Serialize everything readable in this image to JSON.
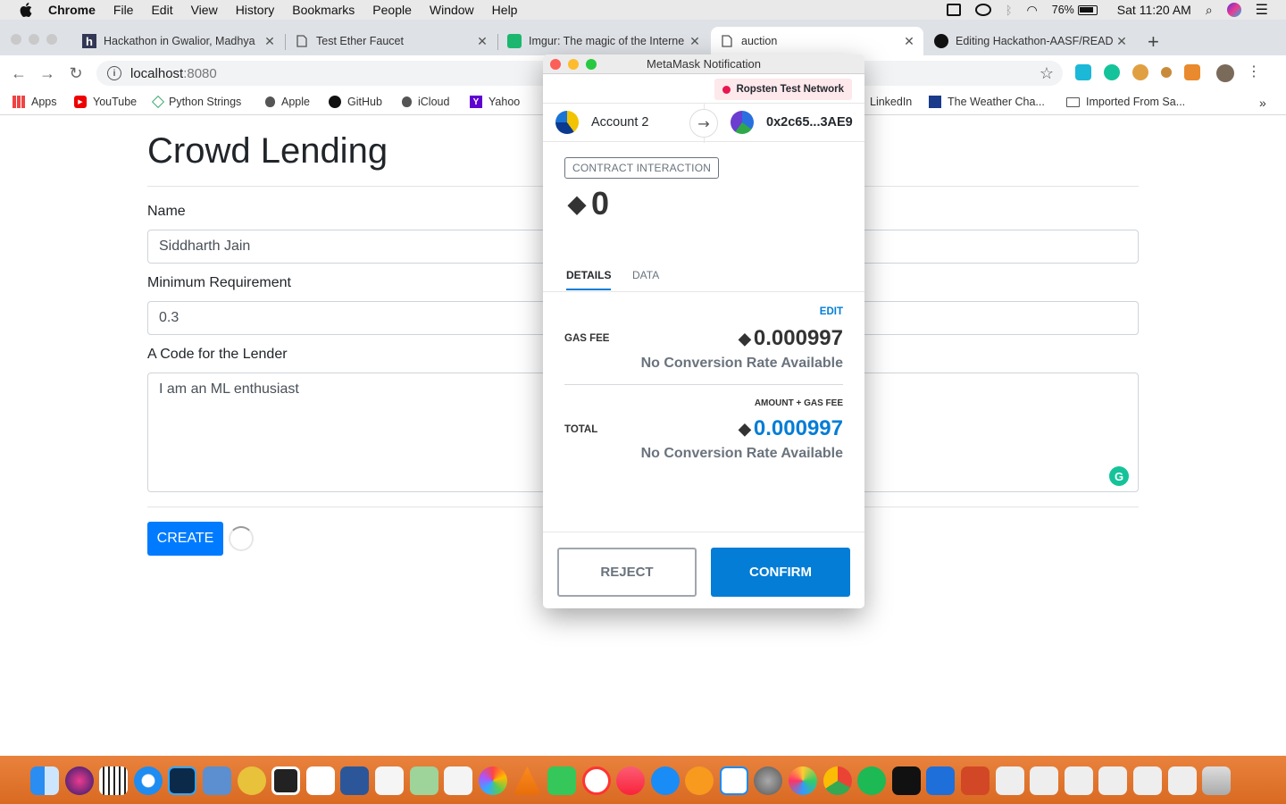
{
  "menubar": {
    "app": "Chrome",
    "items": [
      "File",
      "Edit",
      "View",
      "History",
      "Bookmarks",
      "People",
      "Window",
      "Help"
    ],
    "battery": "76%",
    "clock": "Sat 11:20 AM"
  },
  "tabs": [
    {
      "title": "Hackathon in Gwalior, Madhya",
      "icon": "hackerearth-icon",
      "active": false
    },
    {
      "title": "Test Ether Faucet",
      "icon": "document-icon",
      "active": false
    },
    {
      "title": "Imgur: The magic of the Interne",
      "icon": "imgur-icon",
      "active": false
    },
    {
      "title": "auction",
      "icon": "document-icon",
      "active": true
    },
    {
      "title": "Editing Hackathon-AASF/READ",
      "icon": "github-icon",
      "active": false
    }
  ],
  "omnibox": {
    "host": "localhost",
    "port": ":8080"
  },
  "bookmarks": [
    {
      "label": "Apps",
      "icon": "apps-grid-icon"
    },
    {
      "label": "YouTube",
      "icon": "youtube-icon"
    },
    {
      "label": "Python Strings",
      "icon": "python-icon"
    },
    {
      "label": "Apple",
      "icon": "apple-icon"
    },
    {
      "label": "GitHub",
      "icon": "github-icon"
    },
    {
      "label": "iCloud",
      "icon": "apple-icon"
    },
    {
      "label": "Yahoo",
      "icon": "yahoo-icon"
    },
    {
      "label": "LinkedIn",
      "icon": "linkedin-icon"
    },
    {
      "label": "The Weather Cha...",
      "icon": "weather-icon"
    },
    {
      "label": "Imported From Sa...",
      "icon": "folder-icon"
    }
  ],
  "page": {
    "title": "Crowd Lending",
    "name_label": "Name",
    "name_value": "Siddharth Jain",
    "min_label": "Minimum Requirement",
    "min_value": "0.3",
    "code_label": "A Code for the Lender",
    "code_value": "I am an ML enthusiast",
    "create_label": "CREATE"
  },
  "metamask": {
    "window_title": "MetaMask Notification",
    "network": "Ropsten Test Network",
    "from_account": "Account 2",
    "to_address": "0x2c65...3AE9",
    "tag": "CONTRACT INTERACTION",
    "amount": "0",
    "tab_details": "DETAILS",
    "tab_data": "DATA",
    "edit": "EDIT",
    "gas_label": "GAS FEE",
    "gas_value": "0.000997",
    "no_rate": "No Conversion Rate Available",
    "amount_gas_label": "AMOUNT + GAS FEE",
    "total_label": "TOTAL",
    "total_value": "0.000997",
    "reject": "REJECT",
    "confirm": "CONFIRM",
    "colors": {
      "primary": "#037dd6",
      "network_dot": "#e91550"
    }
  }
}
